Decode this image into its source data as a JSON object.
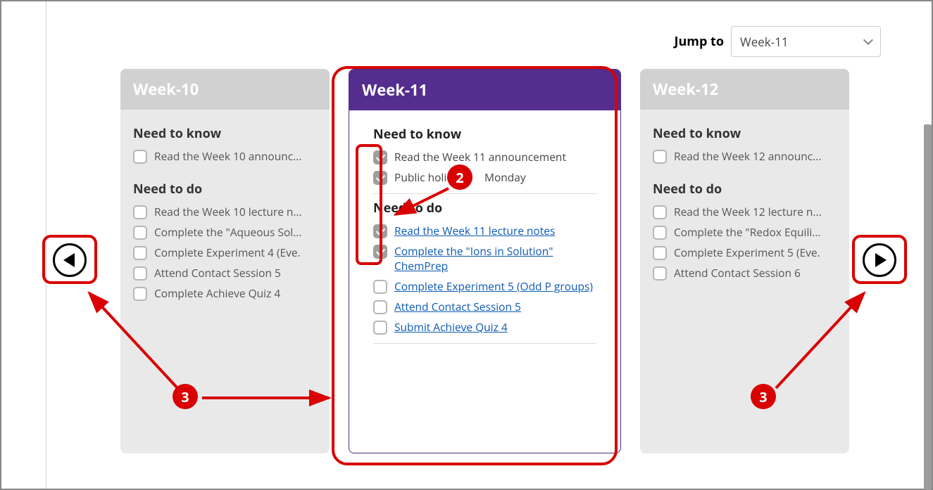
{
  "jumpTo": {
    "label": "Jump to",
    "value": "Week-11"
  },
  "annotations": {
    "badge2": "2",
    "badge3a": "3",
    "badge3b": "3"
  },
  "cards": [
    {
      "title": "Week-10",
      "need_to_know_label": "Need to know",
      "need_to_do_label": "Need to do",
      "know": [
        {
          "text": "Read the Week 10 announc...",
          "checked": false
        }
      ],
      "do": [
        {
          "text": "Read the Week 10 lecture n...",
          "checked": false
        },
        {
          "text": "Complete the \"Aqueous Sol...",
          "checked": false
        },
        {
          "text": "Complete Experiment 4 (Eve.",
          "checked": false
        },
        {
          "text": "Attend Contact Session 5",
          "checked": false
        },
        {
          "text": "Complete Achieve Quiz 4",
          "checked": false
        }
      ]
    },
    {
      "title": "Week-11",
      "need_to_know_label": "Need to know",
      "need_to_do_label": "Need to do",
      "know": [
        {
          "text": "Read the Week 11 announcement",
          "checked": true
        },
        {
          "text": "Public holid           Monday",
          "checked": true
        }
      ],
      "do": [
        {
          "text": "Read the Week 11 lecture notes",
          "checked": true,
          "link": true
        },
        {
          "text": "Complete the \"Ions in Solution\" ChemPrep",
          "checked": true,
          "link": true
        },
        {
          "text": "Complete Experiment 5 (Odd P groups)",
          "checked": false,
          "link": true
        },
        {
          "text": "Attend Contact Session 5",
          "checked": false,
          "link": true
        },
        {
          "text": "Submit Achieve Quiz 4",
          "checked": false,
          "link": true
        }
      ]
    },
    {
      "title": "Week-12",
      "need_to_know_label": "Need to know",
      "need_to_do_label": "Need to do",
      "know": [
        {
          "text": "Read the Week 12 announc...",
          "checked": false
        }
      ],
      "do": [
        {
          "text": "Read the Week 12 lecture n...",
          "checked": false
        },
        {
          "text": "Complete the \"Redox Equili...",
          "checked": false
        },
        {
          "text": "Complete Experiment 5 (Eve.",
          "checked": false
        },
        {
          "text": "Attend Contact Session 6",
          "checked": false
        }
      ]
    }
  ]
}
